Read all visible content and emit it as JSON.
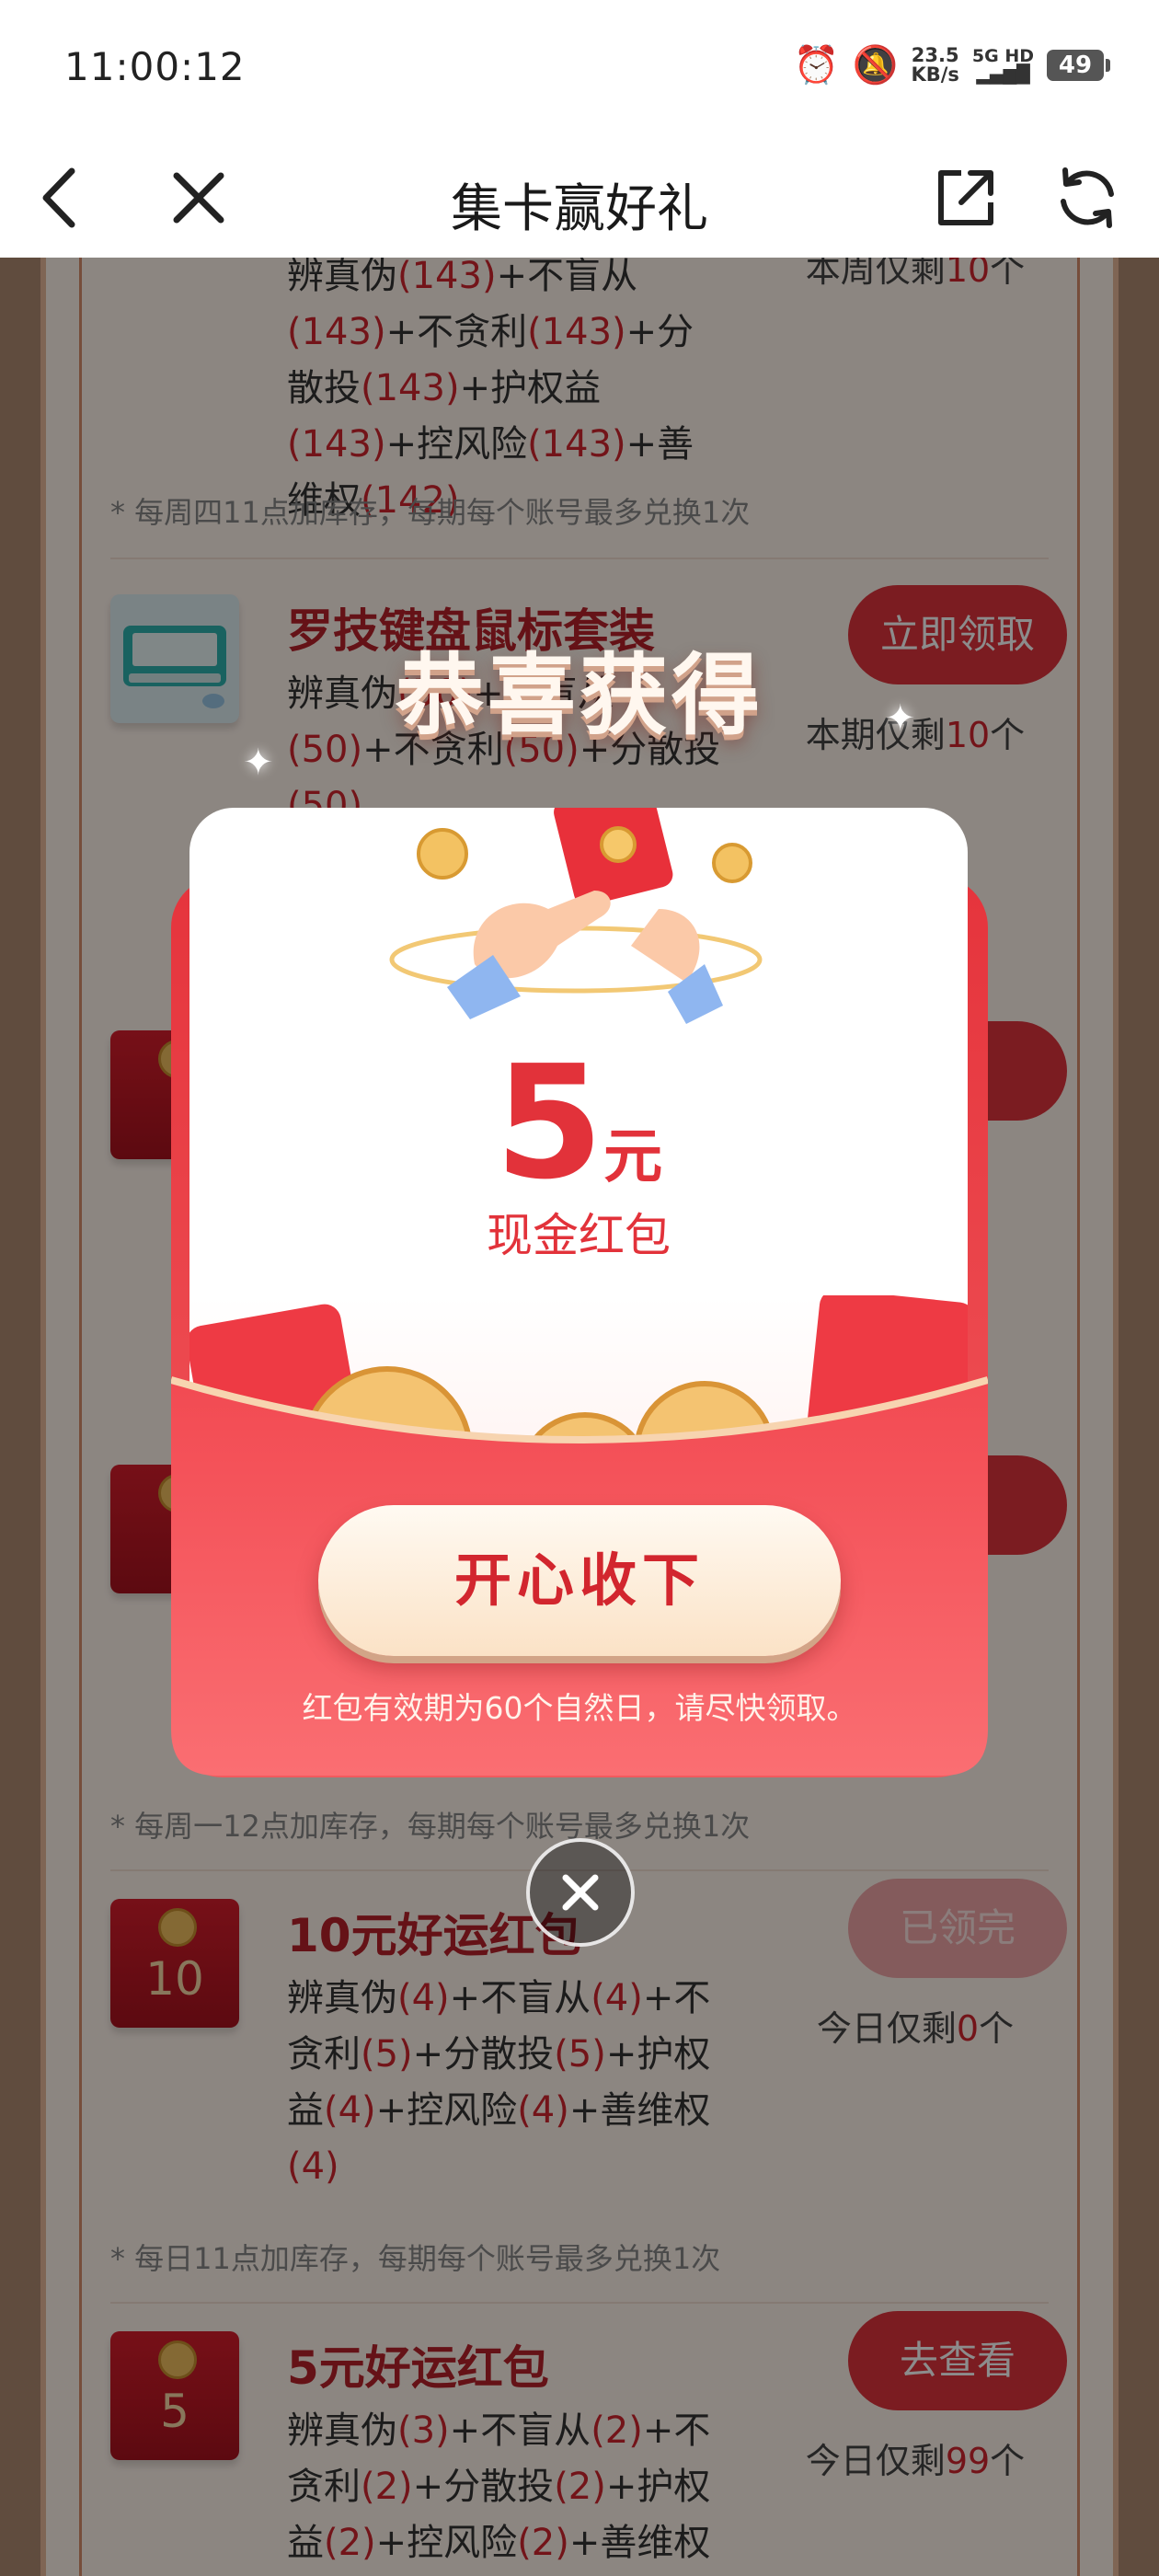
{
  "status_bar": {
    "time": "11:00:12",
    "alarm_icon": "alarm-icon",
    "mute_icon": "notifications-off-icon",
    "speed_value": "23.5",
    "speed_unit": "KB/s",
    "network_label": "5G HD",
    "battery": "49"
  },
  "nav": {
    "title": "集卡赢好礼",
    "back_icon": "chevron-left-icon",
    "close_icon": "close-icon",
    "share_icon": "share-icon",
    "refresh_icon": "refresh-icon"
  },
  "list": {
    "item0": {
      "desc_parts": [
        "辨真伪",
        "(143)",
        "+不盲从",
        "(143)",
        "+不贪利",
        "(143)",
        "+分散投",
        "(143)",
        "+护权益",
        "(143)",
        "+控风险",
        "(143)",
        "+善维权",
        "(142)"
      ],
      "stock_prefix": "本周仅剩",
      "stock_count": "10",
      "stock_suffix": "个",
      "note": "* 每周四11点加库存，每期每个账号最多兑换1次"
    },
    "item1": {
      "title": "罗技键盘鼠标套装",
      "button": "立即领取",
      "desc_parts": [
        "辨真伪",
        "(50)",
        "+不盲从",
        "(50)",
        "+不贪利",
        "(50)",
        "+分散投",
        "(50)"
      ],
      "stock_prefix": "本期仅剩",
      "stock_count": "10",
      "stock_suffix": "个"
    },
    "item4": {
      "note": "* 每周一12点加库存，每期每个账号最多兑换1次"
    },
    "item5": {
      "thumb_value": "10",
      "title": "10元好运红包",
      "button": "已领完",
      "desc_parts": [
        "辨真伪",
        "(4)",
        "+不盲从",
        "(4)",
        "+不贪利",
        "(5)",
        "+分散投",
        "(5)",
        "+护权益",
        "(4)",
        "+控风险",
        "(4)",
        "+善维权",
        "(4)"
      ],
      "stock_prefix": "今日仅剩",
      "stock_count": "0",
      "stock_suffix": "个",
      "note": "* 每日11点加库存，每期每个账号最多兑换1次"
    },
    "item6": {
      "thumb_value": "5",
      "title": "5元好运红包",
      "button": "去查看",
      "desc_parts": [
        "辨真伪",
        "(3)",
        "+不盲从",
        "(2)",
        "+不贪利",
        "(2)",
        "+分散投",
        "(2)",
        "+护权益",
        "(2)",
        "+控风险",
        "(2)",
        "+善维权"
      ],
      "stock_prefix": "今日仅剩",
      "stock_count": "99",
      "stock_suffix": "个"
    }
  },
  "popup": {
    "title": "恭喜获得",
    "amount": "5",
    "unit": "元",
    "label": "现金红包",
    "accept_button": "开心收下",
    "validity_text": "红包有效期为60个自然日，请尽快领取。",
    "close_icon": "close-icon"
  },
  "colors": {
    "accent_red": "#e2323a",
    "gold": "#f0c060",
    "overlay": "rgba(0,0,0,0.45)"
  }
}
